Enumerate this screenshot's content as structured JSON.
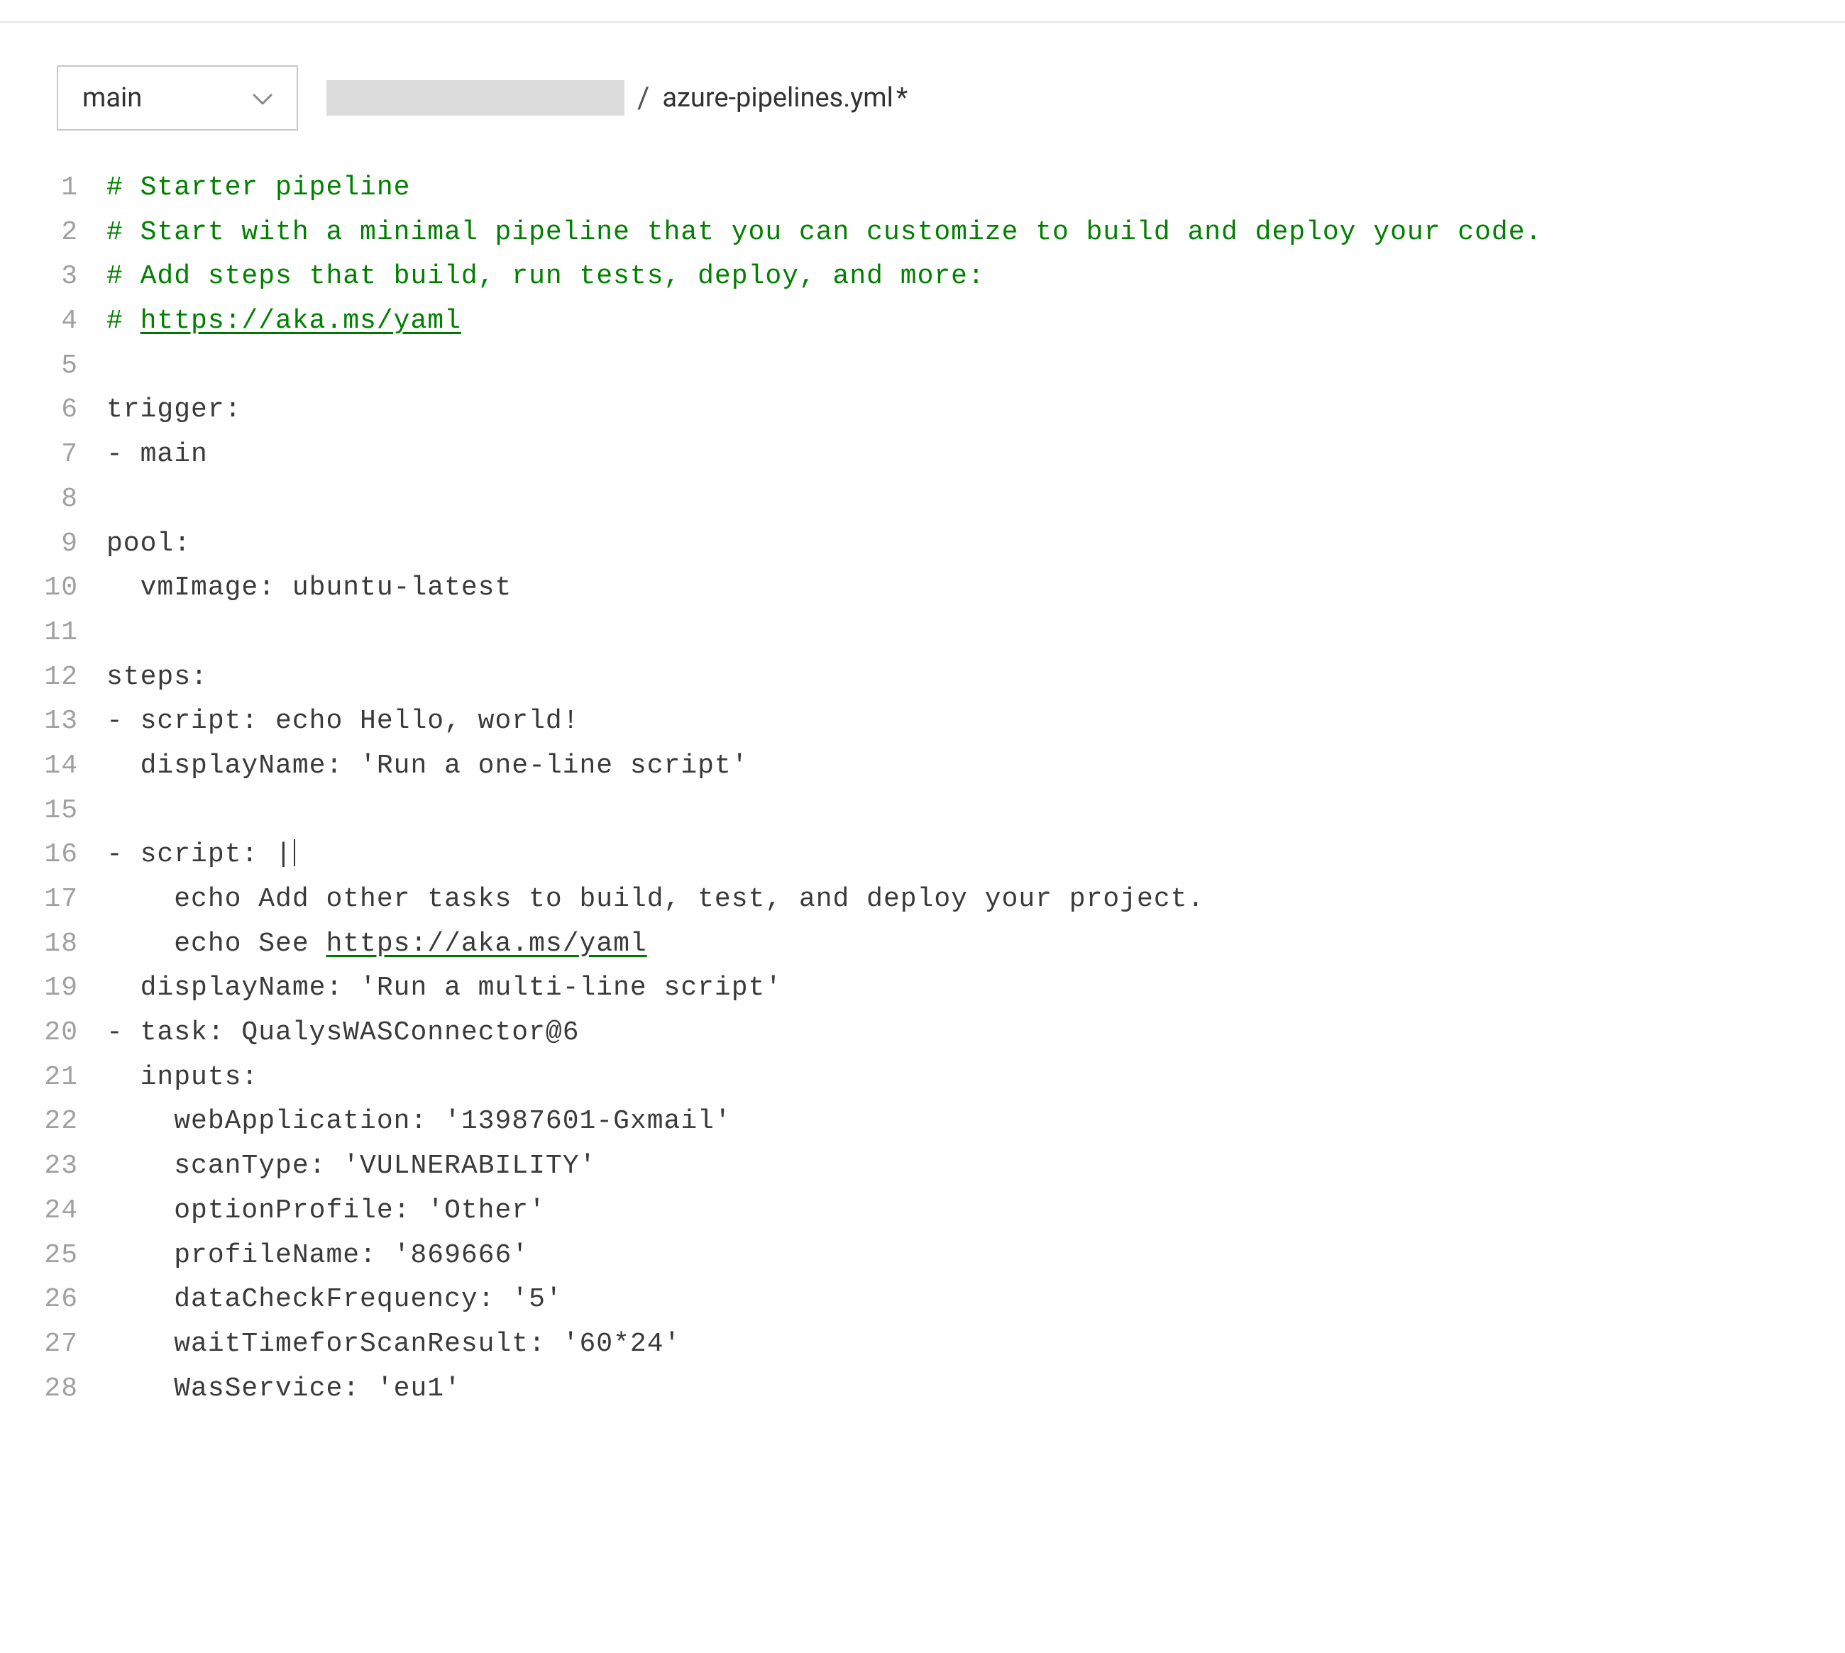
{
  "toolbar": {
    "branch": "main",
    "breadcrumb_separator": "/",
    "breadcrumb_file": "azure-pipelines.yml",
    "dirty_indicator": "*"
  },
  "editor": {
    "lines": [
      {
        "num": 1,
        "text": "# Starter pipeline",
        "comment": true
      },
      {
        "num": 2,
        "text": "# Start with a minimal pipeline that you can customize to build and deploy your code.",
        "comment": true
      },
      {
        "num": 3,
        "text": "# Add steps that build, run tests, deploy, and more:",
        "comment": true
      },
      {
        "num": 4,
        "text_pre": "# ",
        "link": "https://aka.ms/yaml",
        "comment": true
      },
      {
        "num": 5,
        "text": ""
      },
      {
        "num": 6,
        "text": "trigger:"
      },
      {
        "num": 7,
        "text": "- main"
      },
      {
        "num": 8,
        "text": ""
      },
      {
        "num": 9,
        "text": "pool:"
      },
      {
        "num": 10,
        "text": "  vmImage: ubuntu-latest"
      },
      {
        "num": 11,
        "text": ""
      },
      {
        "num": 12,
        "text": "steps:"
      },
      {
        "num": 13,
        "text": "- script: echo Hello, world!"
      },
      {
        "num": 14,
        "text": "  displayName: 'Run a one-line script'"
      },
      {
        "num": 15,
        "text": ""
      },
      {
        "num": 16,
        "text": "- script: |",
        "cursor_after": false
      },
      {
        "num": 17,
        "text": "    echo Add other tasks to build, test, and deploy your project."
      },
      {
        "num": 18,
        "text_pre": "    echo See ",
        "link": "https://aka.ms/yaml"
      },
      {
        "num": 19,
        "text": "  displayName: 'Run a multi-line script'"
      },
      {
        "num": 20,
        "text": "- task: QualysWASConnector@6"
      },
      {
        "num": 21,
        "text": "  inputs:"
      },
      {
        "num": 22,
        "text": "    webApplication: '13987601-Gxmail'"
      },
      {
        "num": 23,
        "text": "    scanType: 'VULNERABILITY'"
      },
      {
        "num": 24,
        "text": "    optionProfile: 'Other'"
      },
      {
        "num": 25,
        "text": "    profileName: '869666'"
      },
      {
        "num": 26,
        "text": "    dataCheckFrequency: '5'"
      },
      {
        "num": 27,
        "text": "    waitTimeforScanResult: '60*24'"
      },
      {
        "num": 28,
        "text": "    WasService: 'eu1'"
      }
    ]
  }
}
